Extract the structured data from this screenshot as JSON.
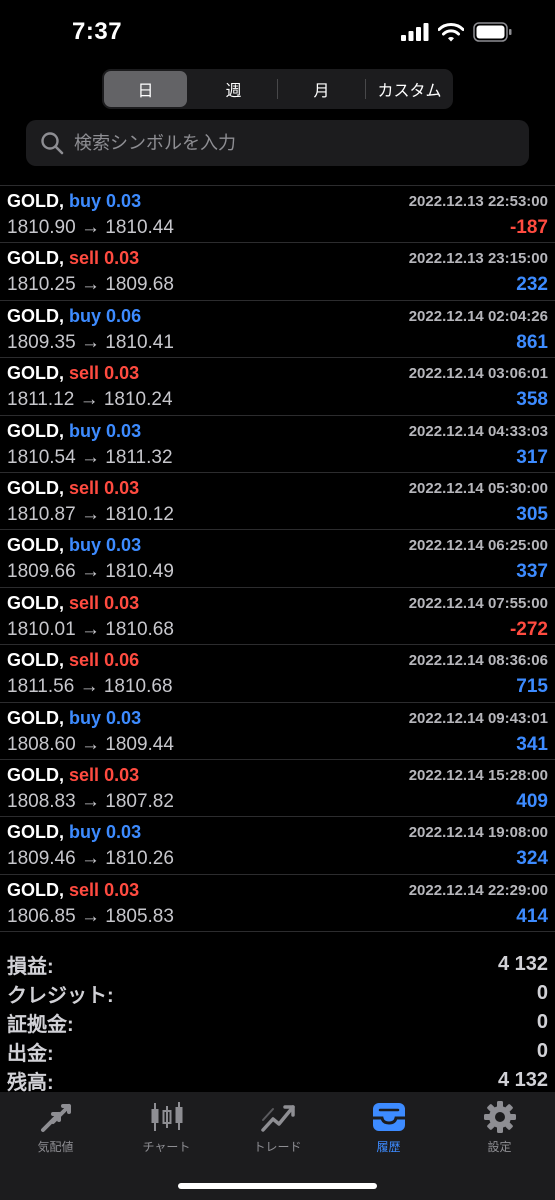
{
  "status": {
    "time": "7:37"
  },
  "period_tabs": [
    {
      "label": "日",
      "active": true
    },
    {
      "label": "週",
      "active": false
    },
    {
      "label": "月",
      "active": false
    },
    {
      "label": "カスタム",
      "active": false
    }
  ],
  "search": {
    "placeholder": "検索シンボルを入力",
    "value": ""
  },
  "trades": [
    {
      "symbol": "GOLD,",
      "side": "buy",
      "volume": "0.03",
      "time": "2022.12.13 22:53:00",
      "open": "1810.90",
      "arrow": "→",
      "close": "1810.44",
      "profit": "-187"
    },
    {
      "symbol": "GOLD,",
      "side": "sell",
      "volume": "0.03",
      "time": "2022.12.13 23:15:00",
      "open": "1810.25",
      "arrow": "→",
      "close": "1809.68",
      "profit": "232"
    },
    {
      "symbol": "GOLD,",
      "side": "buy",
      "volume": "0.06",
      "time": "2022.12.14 02:04:26",
      "open": "1809.35",
      "arrow": "→",
      "close": "1810.41",
      "profit": "861"
    },
    {
      "symbol": "GOLD,",
      "side": "sell",
      "volume": "0.03",
      "time": "2022.12.14 03:06:01",
      "open": "1811.12",
      "arrow": "→",
      "close": "1810.24",
      "profit": "358"
    },
    {
      "symbol": "GOLD,",
      "side": "buy",
      "volume": "0.03",
      "time": "2022.12.14 04:33:03",
      "open": "1810.54",
      "arrow": "→",
      "close": "1811.32",
      "profit": "317"
    },
    {
      "symbol": "GOLD,",
      "side": "sell",
      "volume": "0.03",
      "time": "2022.12.14 05:30:00",
      "open": "1810.87",
      "arrow": "→",
      "close": "1810.12",
      "profit": "305"
    },
    {
      "symbol": "GOLD,",
      "side": "buy",
      "volume": "0.03",
      "time": "2022.12.14 06:25:00",
      "open": "1809.66",
      "arrow": "→",
      "close": "1810.49",
      "profit": "337"
    },
    {
      "symbol": "GOLD,",
      "side": "sell",
      "volume": "0.03",
      "time": "2022.12.14 07:55:00",
      "open": "1810.01",
      "arrow": "→",
      "close": "1810.68",
      "profit": "-272"
    },
    {
      "symbol": "GOLD,",
      "side": "sell",
      "volume": "0.06",
      "time": "2022.12.14 08:36:06",
      "open": "1811.56",
      "arrow": "→",
      "close": "1810.68",
      "profit": "715"
    },
    {
      "symbol": "GOLD,",
      "side": "buy",
      "volume": "0.03",
      "time": "2022.12.14 09:43:01",
      "open": "1808.60",
      "arrow": "→",
      "close": "1809.44",
      "profit": "341"
    },
    {
      "symbol": "GOLD,",
      "side": "sell",
      "volume": "0.03",
      "time": "2022.12.14 15:28:00",
      "open": "1808.83",
      "arrow": "→",
      "close": "1807.82",
      "profit": "409"
    },
    {
      "symbol": "GOLD,",
      "side": "buy",
      "volume": "0.03",
      "time": "2022.12.14 19:08:00",
      "open": "1809.46",
      "arrow": "→",
      "close": "1810.26",
      "profit": "324"
    },
    {
      "symbol": "GOLD,",
      "side": "sell",
      "volume": "0.03",
      "time": "2022.12.14 22:29:00",
      "open": "1806.85",
      "arrow": "→",
      "close": "1805.83",
      "profit": "414"
    }
  ],
  "summary": [
    {
      "label": "損益:",
      "value": "4 132"
    },
    {
      "label": "クレジット:",
      "value": "0"
    },
    {
      "label": "証拠金:",
      "value": "0"
    },
    {
      "label": "出金:",
      "value": "0"
    },
    {
      "label": "残高:",
      "value": "4 132"
    }
  ],
  "tab_bar": [
    {
      "label": "気配値",
      "icon": "quotes-arrows-icon",
      "active": false
    },
    {
      "label": "チャート",
      "icon": "candlestick-chart-icon",
      "active": false
    },
    {
      "label": "トレード",
      "icon": "trade-trend-icon",
      "active": false
    },
    {
      "label": "履歴",
      "icon": "history-inbox-icon",
      "active": true
    },
    {
      "label": "設定",
      "icon": "settings-gear-icon",
      "active": false
    }
  ],
  "colors": {
    "buy": "#3d8bff",
    "sell": "#ff4b40",
    "background": "#000000",
    "active_tab": "#3d8bff"
  }
}
